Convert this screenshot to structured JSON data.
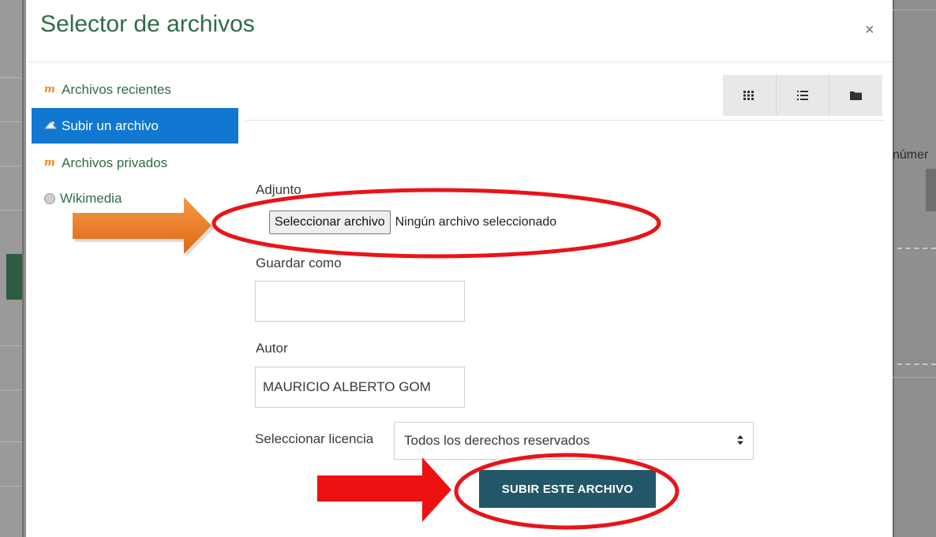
{
  "background": {
    "right_text": "númer"
  },
  "dialog": {
    "title": "Selector de archivos",
    "close_glyph": "×"
  },
  "nav": {
    "items": [
      {
        "label": "Archivos recientes",
        "icon": "moodle-icon",
        "active": false
      },
      {
        "label": "Subir un archivo",
        "icon": "upload-icon",
        "active": true
      },
      {
        "label": "Archivos privados",
        "icon": "moodle-icon",
        "active": false
      },
      {
        "label": "Wikimedia",
        "icon": "wikimedia-icon",
        "active": false
      }
    ]
  },
  "view_toggles": {
    "icons": [
      "grid-view-icon",
      "list-view-icon",
      "folder-view-icon"
    ]
  },
  "form": {
    "attachment_label": "Adjunto",
    "file_button_label": "Seleccionar archivo",
    "file_status": "Ningún archivo seleccionado",
    "save_as_label": "Guardar como",
    "save_as_value": "",
    "author_label": "Autor",
    "author_value": "MAURICIO ALBERTO GOM",
    "license_label": "Seleccionar licencia",
    "license_value": "Todos los derechos reservados",
    "submit_label": "SUBIR ESTE ARCHIVO"
  },
  "annotations": {
    "arrow_colors": [
      "#f07a22",
      "#ee1111"
    ],
    "highlight_color": "#e8141a"
  }
}
